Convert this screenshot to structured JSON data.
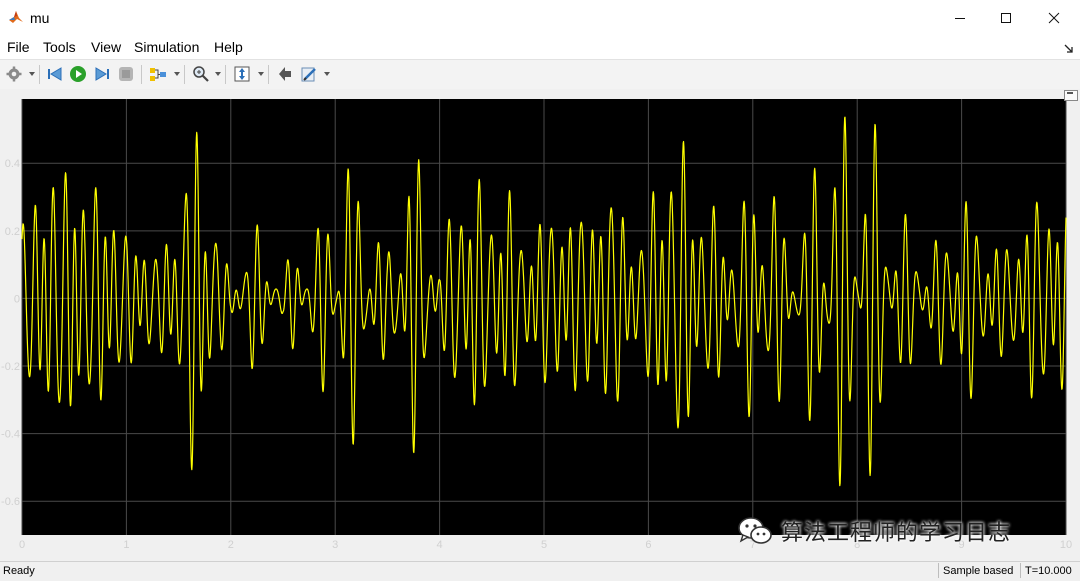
{
  "window": {
    "title": "mu"
  },
  "menu": {
    "items": [
      "File",
      "Tools",
      "View",
      "Simulation",
      "Help"
    ]
  },
  "toolbar": {
    "icons": [
      "gear-icon",
      "step-back-icon",
      "run-icon",
      "step-forward-icon",
      "stop-icon",
      "highlight-signal-icon",
      "zoom-icon",
      "autoscale-icon",
      "restore-icon",
      "style-icon"
    ]
  },
  "colors": {
    "plot_bg": "#000000",
    "signal": "#ffff00",
    "grid": "#4a4a4a",
    "tick_text": "#d0d0d0"
  },
  "chart_data": {
    "type": "line",
    "title": "",
    "xlabel": "",
    "ylabel": "",
    "xlim": [
      0,
      10
    ],
    "ylim": [
      -0.7,
      0.59
    ],
    "grid": true,
    "x_ticks": [
      0,
      1,
      2,
      3,
      4,
      5,
      6,
      7,
      8,
      9,
      10
    ],
    "y_ticks": [
      -0.6,
      -0.4,
      -0.2,
      0,
      0.2,
      0.4
    ],
    "x_tick_labels": [
      "0",
      "1",
      "2",
      "3",
      "4",
      "5",
      "6",
      "7",
      "8",
      "9",
      "10"
    ],
    "y_tick_labels": [
      "-0.6",
      "-0.4",
      "-0.2",
      "0",
      "0.2",
      "0.4"
    ],
    "series": [
      {
        "color": "#ffff00",
        "x": [
          0,
          0.1,
          0.2,
          0.3,
          0.4,
          0.5,
          0.6,
          0.7,
          0.8,
          0.9,
          1.0,
          1.1,
          1.2,
          1.3,
          1.4,
          1.5,
          1.6,
          1.7,
          1.8,
          1.9,
          2.0,
          2.1,
          2.2,
          2.3,
          2.4,
          2.5,
          2.6,
          2.7,
          2.8,
          2.9,
          3.0,
          3.1,
          3.2,
          3.3,
          3.4,
          3.5,
          3.6,
          3.7,
          3.8,
          3.9,
          4.0,
          4.1,
          4.2,
          4.3,
          4.4,
          4.5,
          4.6,
          4.7,
          4.8,
          4.9,
          5.0,
          5.1,
          5.2,
          5.3,
          5.4,
          5.5,
          5.6,
          5.7,
          5.8,
          5.9,
          6.0,
          6.1,
          6.2,
          6.3,
          6.4,
          6.5,
          6.6,
          6.7,
          6.8,
          6.9,
          7.0,
          7.1,
          7.2,
          7.3,
          7.4,
          7.5,
          7.6,
          7.7,
          7.8,
          7.9,
          8.0,
          8.1,
          8.2,
          8.3,
          8.4,
          8.5,
          8.6,
          8.7,
          8.8,
          8.9,
          9.0,
          9.1,
          9.2,
          9.3,
          9.4,
          9.5,
          9.6,
          9.7,
          9.8,
          9.9,
          10.0
        ],
        "amplitude": [
          0.22,
          0.34,
          0.38,
          0.36,
          0.42,
          0.45,
          0.3,
          0.36,
          0.33,
          0.28,
          0.2,
          0.18,
          0.22,
          0.12,
          0.2,
          0.34,
          0.45,
          0.5,
          0.42,
          0.16,
          0.05,
          0.12,
          0.22,
          0.15,
          0.12,
          0.05,
          0.15,
          0.22,
          0.14,
          0.26,
          0.33,
          0.38,
          0.35,
          0.3,
          0.2,
          0.12,
          0.28,
          0.43,
          0.38,
          0.2,
          0.1,
          0.22,
          0.42,
          0.4,
          0.3,
          0.3,
          0.34,
          0.3,
          0.18,
          0.22,
          0.26,
          0.28,
          0.26,
          0.3,
          0.28,
          0.28,
          0.35,
          0.34,
          0.22,
          0.16,
          0.26,
          0.38,
          0.48,
          0.45,
          0.4,
          0.33,
          0.26,
          0.22,
          0.2,
          0.26,
          0.34,
          0.36,
          0.32,
          0.2,
          0.12,
          0.24,
          0.38,
          0.52,
          0.5,
          0.46,
          0.42,
          0.55,
          0.38,
          0.3,
          0.22,
          0.2,
          0.16,
          0.12,
          0.18,
          0.25,
          0.3,
          0.26,
          0.22,
          0.18,
          0.15,
          0.2,
          0.26,
          0.3,
          0.32,
          0.3,
          0.3
        ]
      }
    ]
  },
  "watermark": {
    "text": "算法工程师的学习日志",
    "icon": "wechat-icon"
  },
  "status": {
    "left": "Ready",
    "mode": "Sample based",
    "time": "T=10.000"
  }
}
